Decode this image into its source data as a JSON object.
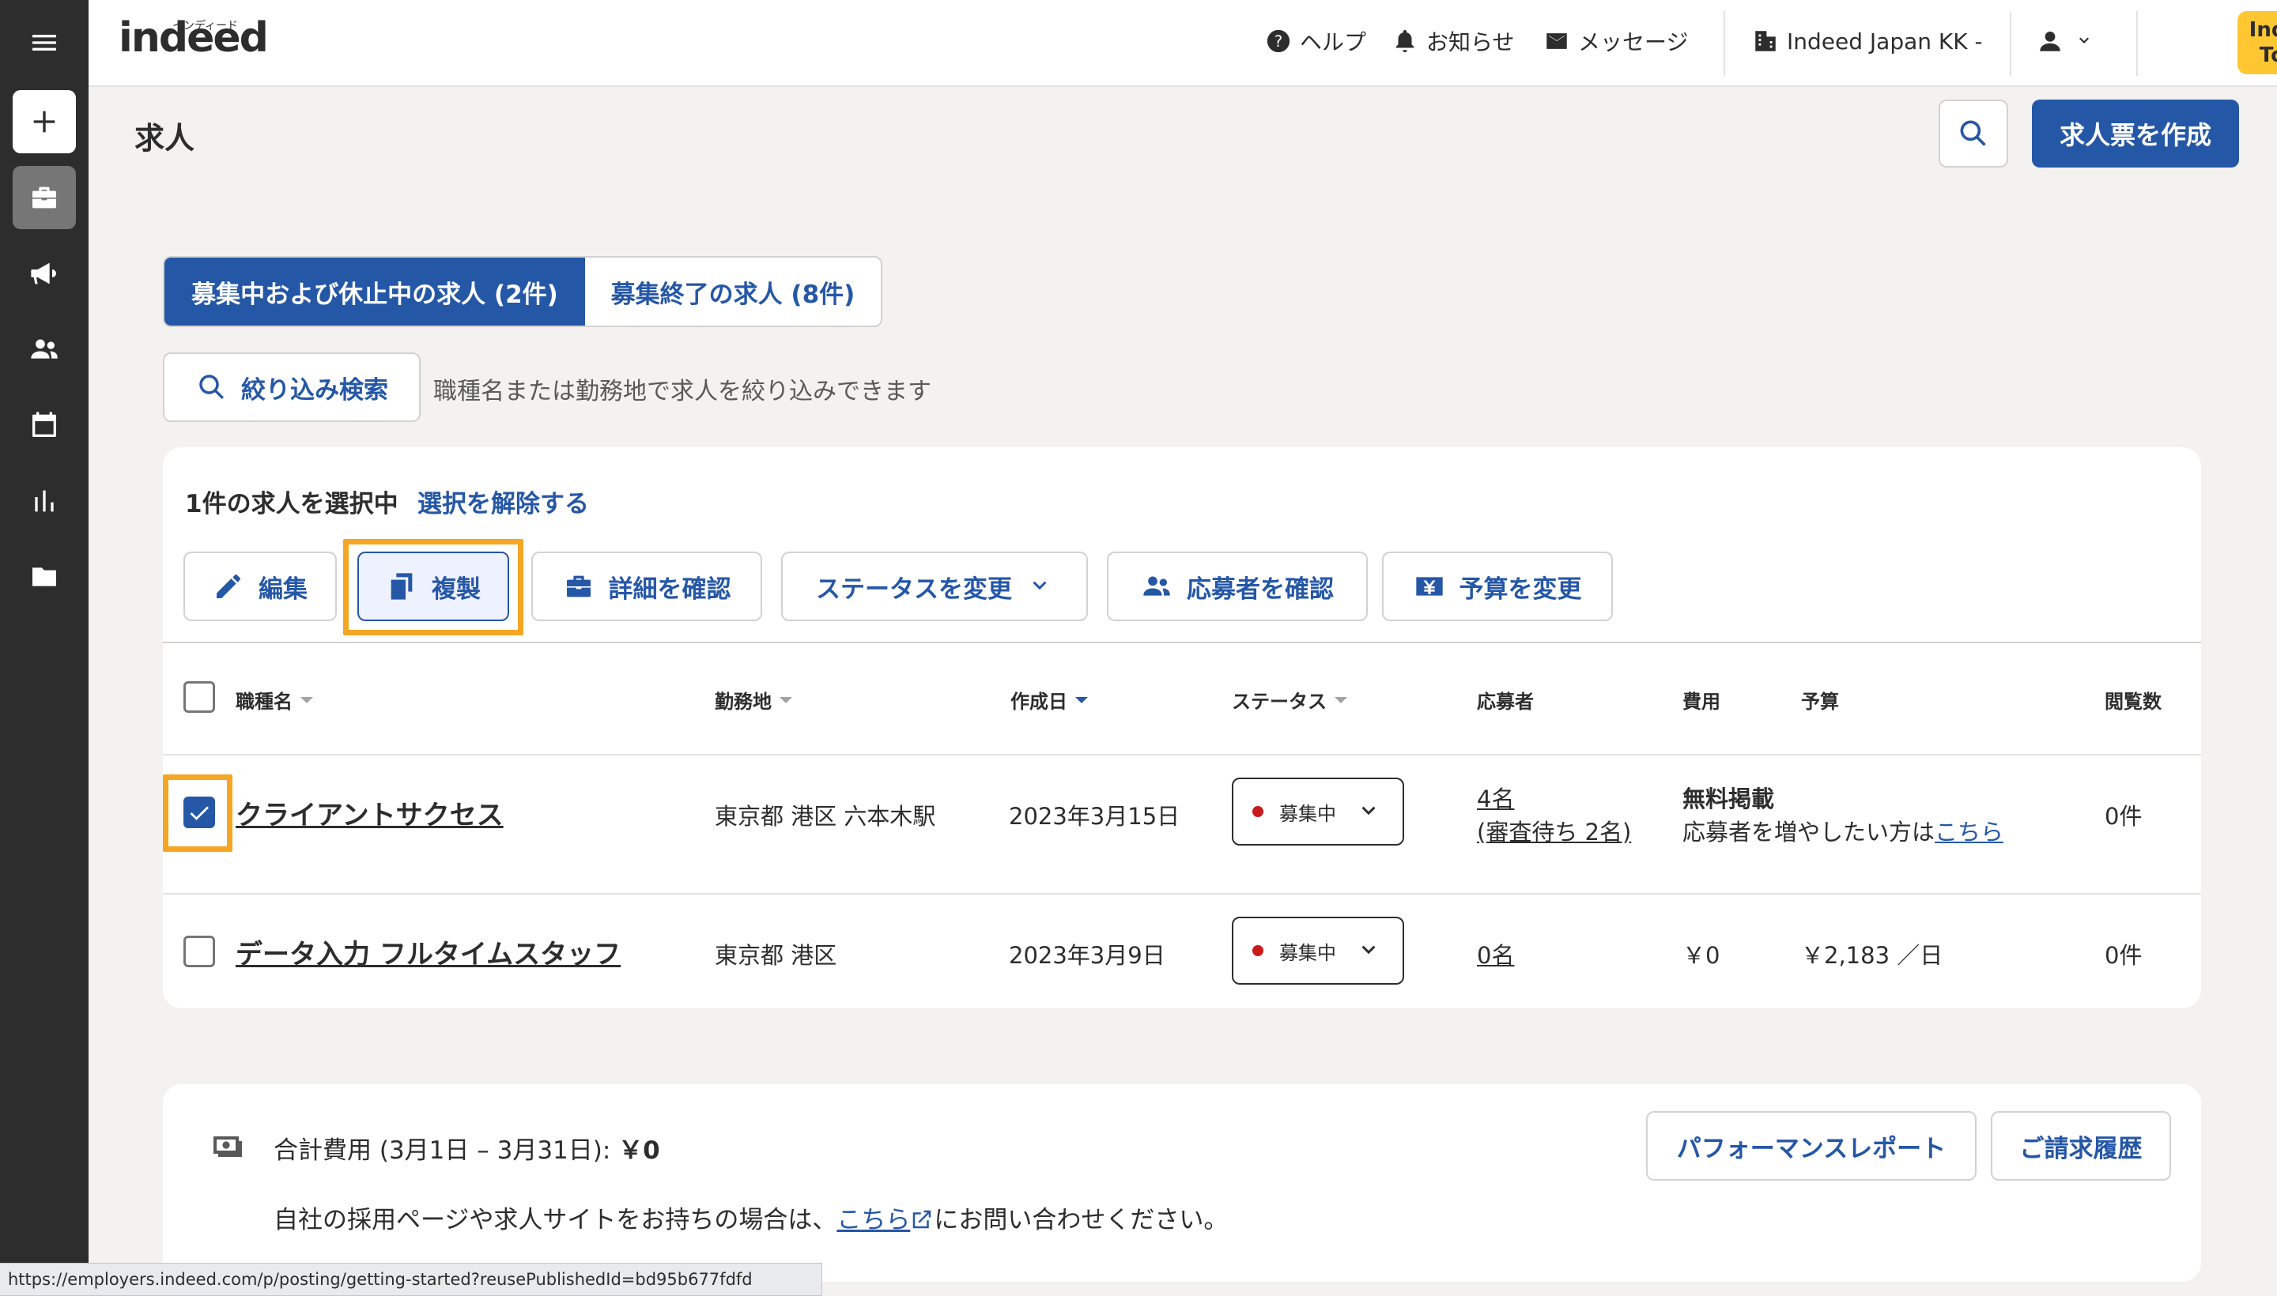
{
  "app": {
    "logo_text": "indeed",
    "logo_kana": "インディード"
  },
  "topnav": {
    "help": "ヘルプ",
    "notifications": "お知らせ",
    "messages": "メッセージ",
    "company": "Indeed Japan KK -",
    "tools_line1": "Indeed",
    "tools_line2": "Tools"
  },
  "page": {
    "title": "求人",
    "create_button": "求人票を作成"
  },
  "tabs": [
    {
      "label": "募集中および休止中の求人 (2件)",
      "active": true
    },
    {
      "label": "募集終了の求人 (8件)",
      "active": false
    }
  ],
  "filter": {
    "button": "絞り込み検索",
    "hint": "職種名または勤務地で求人を絞り込みできます"
  },
  "selection": {
    "text": "1件の求人を選択中",
    "clear": "選択を解除する"
  },
  "actions": {
    "edit": "編集",
    "duplicate": "複製",
    "details": "詳細を確認",
    "change_status": "ステータスを変更",
    "applicants": "応募者を確認",
    "budget": "予算を変更"
  },
  "table": {
    "headers": {
      "title": "職種名",
      "location": "勤務地",
      "created": "作成日",
      "status": "ステータス",
      "applicants": "応募者",
      "cost": "費用",
      "budget": "予算",
      "views": "閲覧数"
    },
    "rows": [
      {
        "checked": true,
        "title": "クライアントサクセス",
        "location": "東京都 港区 六本木駅",
        "created": "2023年3月15日",
        "status": "募集中",
        "applicants": "4名",
        "applicants_sub": "(審査待ち 2名)",
        "cost_title": "無料掲載",
        "cost_note": "応募者を増やしたい方は",
        "cost_link": "こちら",
        "budget": "",
        "views": "0件"
      },
      {
        "checked": false,
        "title": "データ入力 フルタイムスタッフ",
        "location": "東京都 港区",
        "created": "2023年3月9日",
        "status": "募集中",
        "applicants": "0名",
        "cost": "￥0",
        "budget": "￥2,183 ／日",
        "views": "0件"
      }
    ]
  },
  "cost_summary": {
    "label": "合計費用 (3月1日 – 3月31日):",
    "amount": "￥0",
    "note_before": "自社の採用ページや求人サイトをお持ちの場合は、",
    "note_link": "こちら",
    "note_after": "にお問い合わせください。",
    "performance_button": "パフォーマンスレポート",
    "billing_button": "ご請求履歴"
  },
  "status_bar_url": "https://employers.indeed.com/p/posting/getting-started?reusePublishedId=bd95b677fdfd",
  "colors": {
    "accent": "#2557a7",
    "highlight": "#f5a623",
    "tools": "#fec732",
    "rail": "#2d2d2d"
  }
}
